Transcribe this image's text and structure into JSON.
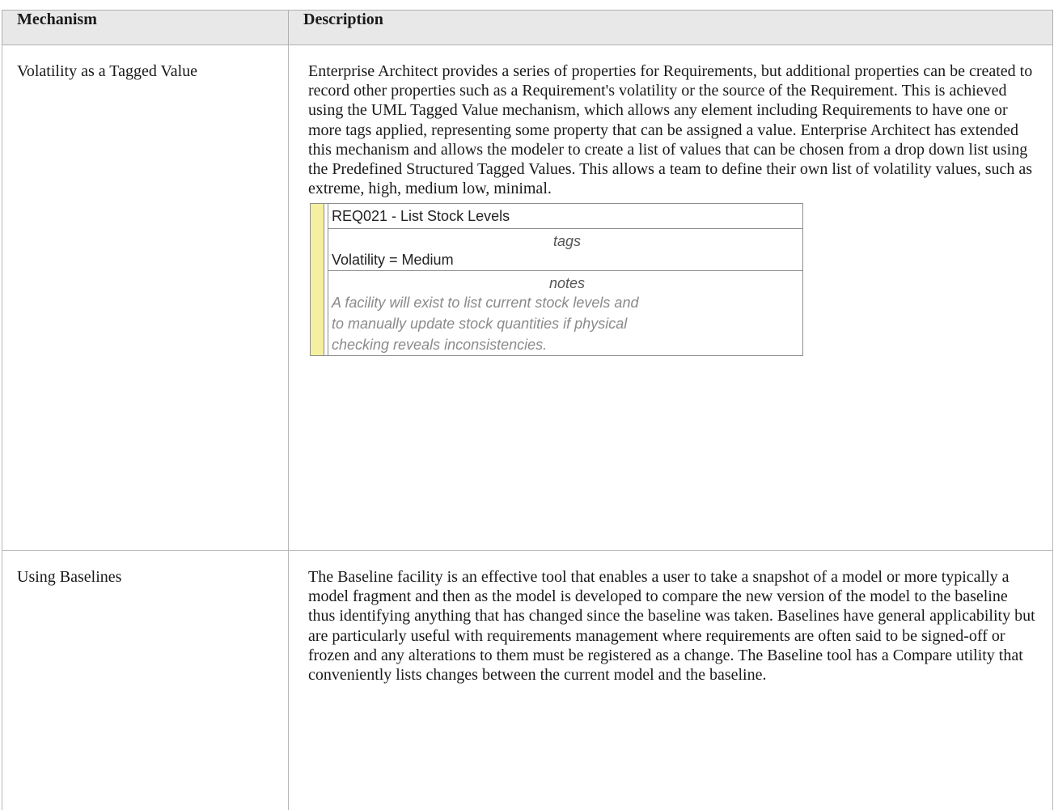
{
  "table": {
    "headers": [
      "Mechanism",
      "Description"
    ],
    "rows": [
      {
        "mechanism": "Volatility as a Tagged Value",
        "description": "Enterprise Architect provides a series of properties for Requirements, but additional properties can be created to record other properties such as a Requirement's volatility or the source of the Requirement. This is achieved using the UML Tagged Value mechanism, which allows any element including Requirements to have one or more tags applied, representing some property that can be assigned a value. Enterprise Architect has extended this mechanism and allows the modeler to create a list of values that can be chosen from a drop down list using the Predefined Structured Tagged Values. This allows a team to define their own list of volatility values, such as extreme, high, medium low, minimal."
      },
      {
        "mechanism": "Using Baselines",
        "description": "The Baseline facility is an effective tool that enables a user to take a snapshot of a model or more typically a model fragment and then as the model is developed to compare the new version of the model to the baseline thus identifying anything that has changed since the baseline was taken. Baselines have general applicability but are particularly useful with requirements management where requirements are often said to be signed-off or frozen and any alterations to them must be registered as a change. The Baseline tool has a Compare utility that conveniently lists changes between the current model and the baseline."
      }
    ]
  },
  "requirement_element": {
    "title": "REQ021 - List Stock Levels",
    "tags_heading": "tags",
    "tag_value": "Volatility = Medium",
    "notes_heading": "notes",
    "notes_lines": [
      "A facility will exist to list current stock levels and",
      "to manually update stock quantities if physical",
      "checking reveals inconsistencies."
    ],
    "stripe_color": "#f4f0a0"
  }
}
